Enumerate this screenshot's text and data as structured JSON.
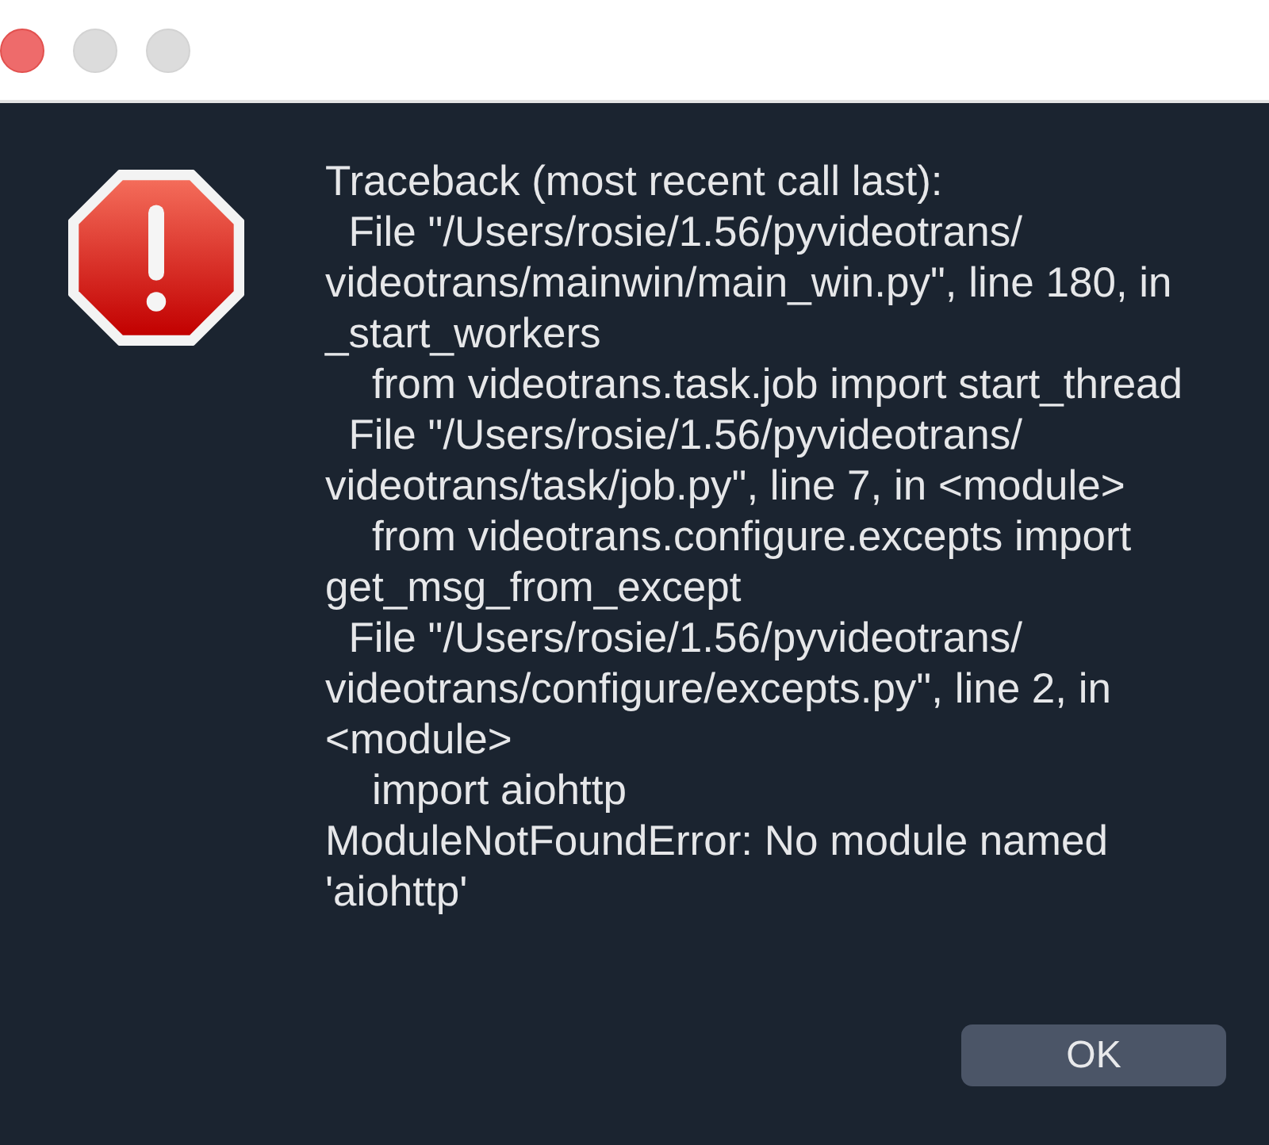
{
  "window_controls": [
    {
      "kind": "close",
      "disabled": false
    },
    {
      "kind": "minimize",
      "disabled": true
    },
    {
      "kind": "zoom",
      "disabled": true
    }
  ],
  "message_lines": [
    "Traceback (most recent call last):",
    "  File \"/Users/rosie/1.56/pyvideotrans/",
    "videotrans/mainwin/main_win.py\", line 180, in",
    "_start_workers",
    "    from videotrans.task.job import start_thread",
    "  File \"/Users/rosie/1.56/pyvideotrans/",
    "videotrans/task/job.py\", line 7, in <module>",
    "    from videotrans.configure.excepts import",
    "get_msg_from_except",
    "  File \"/Users/rosie/1.56/pyvideotrans/",
    "videotrans/configure/excepts.py\", line 2, in",
    "<module>",
    "    import aiohttp",
    "ModuleNotFoundError: No module named",
    "'aiohttp'"
  ],
  "buttons": [
    {
      "label": "OK"
    }
  ]
}
